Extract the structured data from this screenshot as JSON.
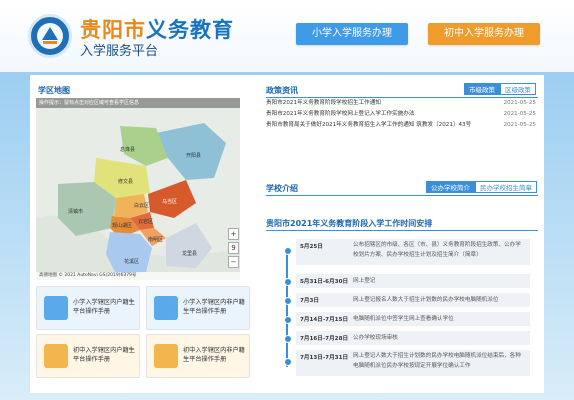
{
  "header": {
    "title_a": "贵阳市",
    "title_b": "义务教育",
    "subtitle": "入学服务平台",
    "btn_primary": "小学入学服务办理",
    "btn_middle": "初中入学服务办理",
    "colors": {
      "blue": "#3f9ae8",
      "orange": "#f09c2d"
    }
  },
  "district_map": {
    "heading": "学区地图",
    "notice": "操作提示：鼠标点击对应区域可查看学区信息",
    "footer": "高德地图 © 2021 AutoNavi GS(2019)6379号",
    "zoom_in": "+",
    "zoom_level": "9",
    "zoom_out": "−",
    "districts": [
      "息烽县",
      "开阳县",
      "修文县",
      "清镇市",
      "白云区",
      "乌当区",
      "观山湖区",
      "云岩区",
      "南明区",
      "花溪区",
      "龙里县"
    ]
  },
  "tiles": [
    {
      "text": "小学入学辖区内户籍生平台操作手册",
      "icon": "book-icon"
    },
    {
      "text": "小学入学辖区内非户籍生平台操作手册",
      "icon": "book-icon"
    },
    {
      "text": "初中入学辖区内户籍生平台操作手册",
      "icon": "student-icon"
    },
    {
      "text": "初中入学辖区内非户籍生平台操作手册",
      "icon": "student-icon"
    }
  ],
  "policy": {
    "heading": "政策资讯",
    "tabs": [
      "市级政策",
      "区级政策"
    ],
    "items": [
      {
        "title": "贵阳市2021年义务教育阶段学校招生工作通知",
        "date": "2021-05-25"
      },
      {
        "title": "贵阳市2021年义务教育阶段学校网上登记入学工作实施办法",
        "date": "2021-05-25"
      },
      {
        "title": "贵阳市教育局关于做好2021年义务教育招生入学工作的通知  筑教发〔2021〕43号",
        "date": "2021-05-25"
      }
    ]
  },
  "schools": {
    "heading": "学校介绍",
    "tabs": [
      "公办学校简介",
      "民办学校招生简章"
    ]
  },
  "timeline": {
    "heading": "贵阳市2021年义务教育阶段入学工作时间安排",
    "events": [
      {
        "date": "5月25日",
        "desc": "公布招辖区的市级、各区（市、县）义务教育阶段招生政策、公办学校划片方案、民办学校招生计划及招生简介（简章）"
      },
      {
        "date": "5月31日-6月30日",
        "desc": "网上登记"
      },
      {
        "date": "7月3日",
        "desc": "网上登记报名人数大于招生计划数的民办学校电脑随机派位"
      },
      {
        "date": "7月14日-7月15日",
        "desc": "电脑随机派位中签学生网上查看确认学位"
      },
      {
        "date": "7月16日-7月28日",
        "desc": "公办学校现场审核"
      },
      {
        "date": "7月13日-7月31日",
        "desc": "网上登记人数大于招生计划数的民办学校电脑随机派位结束后，各种电脑随机派位民办学校按现定开展学位确认工作"
      }
    ]
  }
}
